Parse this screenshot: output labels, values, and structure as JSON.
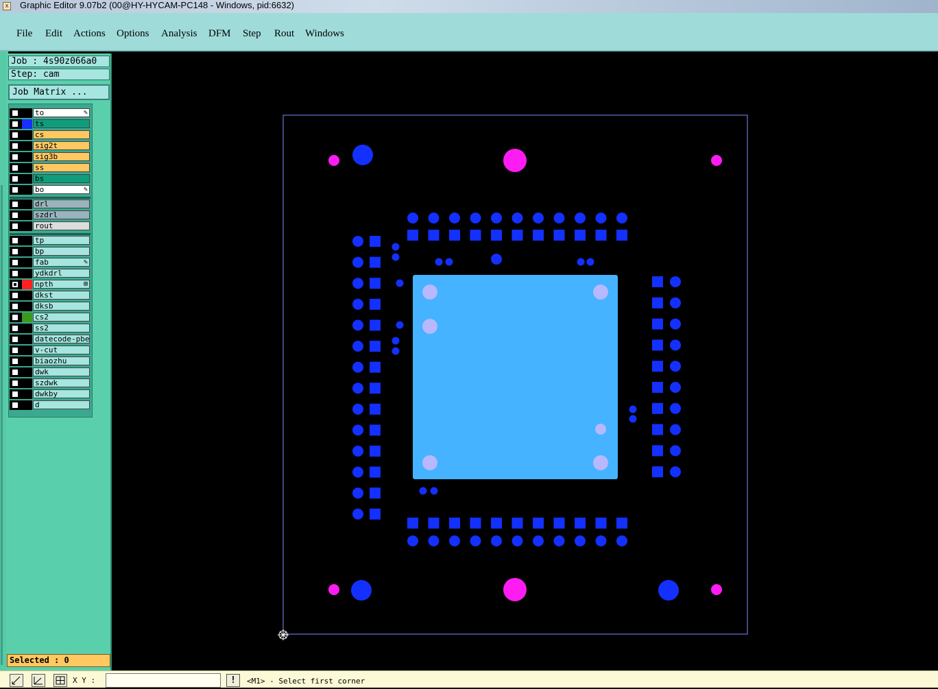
{
  "window": {
    "title": "Graphic Editor 9.07b2 (00@HY-HYCAM-PC148 - Windows, pid:6632)",
    "app_icon": "x-app-icon"
  },
  "menu": [
    "File",
    "Edit",
    "Actions",
    "Options",
    "Analysis",
    "DFM",
    "Step",
    "Rout",
    "Windows"
  ],
  "job": {
    "job_label": "Job : 4s90z066a0",
    "step_label": "Step: cam",
    "matrix_button": "Job Matrix ..."
  },
  "layers": [
    {
      "name": "to",
      "color": "#ffffff",
      "swatch": "",
      "mark": "pencil"
    },
    {
      "name": "ts",
      "color": "#0e9e7c",
      "swatch": "#1530ff",
      "mark": ""
    },
    {
      "name": "cs",
      "color": "#ffc860",
      "swatch": "",
      "mark": ""
    },
    {
      "name": "sig2t",
      "color": "#ffc860",
      "swatch": "",
      "mark": ""
    },
    {
      "name": "sig3b",
      "color": "#ffc860",
      "swatch": "",
      "mark": ""
    },
    {
      "name": "ss",
      "color": "#ffc860",
      "swatch": "",
      "mark": ""
    },
    {
      "name": "bs",
      "color": "#0e9e7c",
      "swatch": "",
      "mark": ""
    },
    {
      "name": "bo",
      "color": "#ffffff",
      "swatch": "",
      "mark": "pencil"
    },
    {
      "name": "drl",
      "color": "#9ab3bd",
      "swatch": "",
      "mark": ""
    },
    {
      "name": "szdrl",
      "color": "#9ab3bd",
      "swatch": "",
      "mark": ""
    },
    {
      "name": "rout",
      "color": "#dcdcdc",
      "swatch": "",
      "mark": ""
    },
    {
      "name": "tp",
      "color": "#a6e5e0",
      "swatch": "",
      "mark": ""
    },
    {
      "name": "bp",
      "color": "#a6e5e0",
      "swatch": "",
      "mark": ""
    },
    {
      "name": "fab",
      "color": "#a6e5e0",
      "swatch": "",
      "mark": "pencil"
    },
    {
      "name": "ydkdrl",
      "color": "#a6e5e0",
      "swatch": "",
      "mark": ""
    },
    {
      "name": "npth",
      "color": "#a6e5e0",
      "swatch": "#ff2020",
      "mark": "grid",
      "checked": true
    },
    {
      "name": "dkst",
      "color": "#a6e5e0",
      "swatch": "",
      "mark": ""
    },
    {
      "name": "dksb",
      "color": "#a6e5e0",
      "swatch": "",
      "mark": ""
    },
    {
      "name": "cs2",
      "color": "#a6e5e0",
      "swatch": "#3a9a1a",
      "mark": ""
    },
    {
      "name": "ss2",
      "color": "#a6e5e0",
      "swatch": "",
      "mark": ""
    },
    {
      "name": "datecode-pbe",
      "color": "#a6e5e0",
      "swatch": "",
      "mark": ""
    },
    {
      "name": "v-cut",
      "color": "#a6e5e0",
      "swatch": "",
      "mark": ""
    },
    {
      "name": "biaozhu",
      "color": "#a6e5e0",
      "swatch": "",
      "mark": ""
    },
    {
      "name": "dwk",
      "color": "#a6e5e0",
      "swatch": "",
      "mark": ""
    },
    {
      "name": "szdwk",
      "color": "#a6e5e0",
      "swatch": "",
      "mark": ""
    },
    {
      "name": "dwkby",
      "color": "#a6e5e0",
      "swatch": "",
      "mark": ""
    },
    {
      "name": "d",
      "color": "#a6e5e0",
      "swatch": "",
      "mark": ""
    }
  ],
  "selected": "Selected : 0",
  "status": {
    "xy_label": "X Y :",
    "xy_value": "",
    "message": "<M1> - Select first corner",
    "tools": [
      "zoom-box-icon",
      "measure-icon",
      "snap-grid-icon"
    ],
    "alert": "!"
  },
  "graphics": {
    "colors": {
      "background": "#000000",
      "profile": "#7f8cff",
      "pad": "#1330ff",
      "npth": "#ff1cf2",
      "thermal_pad": "#45b3ff",
      "thermal_via": "#b8b8ff"
    },
    "origin_marker": "origin-crosshair-icon"
  }
}
